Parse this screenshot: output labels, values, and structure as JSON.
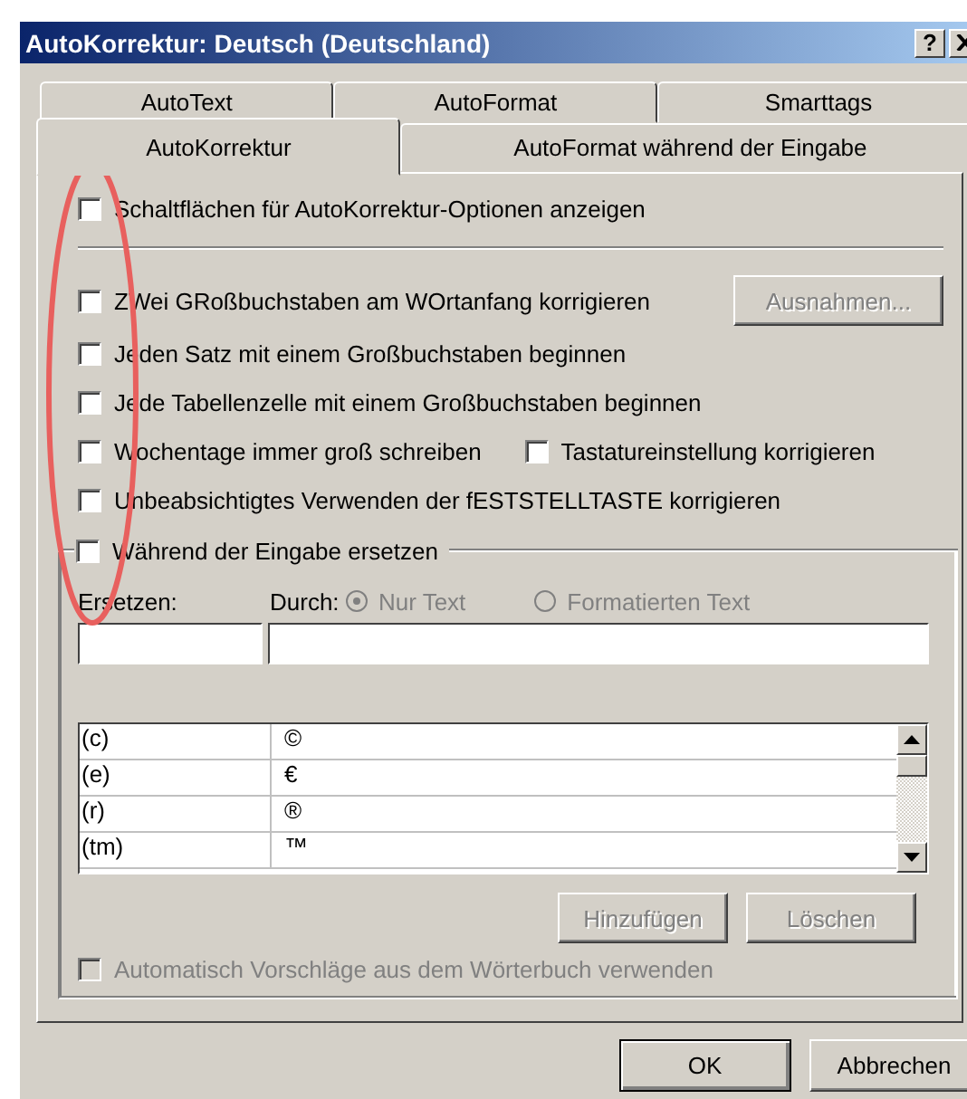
{
  "window": {
    "title": "AutoKorrektur: Deutsch (Deutschland)",
    "help_button": "?"
  },
  "tab_rows": [
    [
      {
        "label": "AutoText",
        "selected": false
      },
      {
        "label": "AutoFormat",
        "selected": false
      },
      {
        "label": "Smarttags",
        "selected": false
      }
    ],
    [
      {
        "label": "AutoKorrektur",
        "selected": true
      },
      {
        "label": "AutoFormat während der Eingabe",
        "selected": false
      }
    ]
  ],
  "top_option": {
    "label": "Schaltflächen für AutoKorrektur-Optionen anzeigen",
    "checked": false
  },
  "option_rows": [
    {
      "items": [
        {
          "label": "ZWei GRoßbuchstaben am WOrtanfang korrigieren",
          "checked": false
        }
      ],
      "button": {
        "label": "Ausnahmen...",
        "disabled": true
      }
    },
    {
      "items": [
        {
          "label": "Jeden Satz mit einem Großbuchstaben beginnen",
          "checked": false
        }
      ]
    },
    {
      "items": [
        {
          "label": "Jede Tabellenzelle mit einem Großbuchstaben beginnen",
          "checked": false
        }
      ]
    },
    {
      "items": [
        {
          "label": "Wochentage immer groß schreiben",
          "checked": false
        },
        {
          "label": "Tastatureinstellung korrigieren",
          "checked": false
        }
      ]
    },
    {
      "items": [
        {
          "label": "Unbeabsichtigtes Verwenden der fESTSTELLTASTE korrigieren",
          "checked": false
        }
      ]
    }
  ],
  "replace_group": {
    "checkbox": {
      "label": "Während der Eingabe ersetzen",
      "checked": false
    },
    "replace_label": "Ersetzen:",
    "with_label": "Durch:",
    "radios": [
      {
        "label": "Nur Text",
        "selected": true,
        "disabled": true
      },
      {
        "label": "Formatierten Text",
        "selected": false,
        "disabled": true
      }
    ],
    "entries": [
      {
        "from": "(c)",
        "to": "©"
      },
      {
        "from": "(e)",
        "to": "€"
      },
      {
        "from": "(r)",
        "to": "®"
      },
      {
        "from": "(tm)",
        "to": "™"
      }
    ],
    "buttons": [
      {
        "label": "Hinzufügen",
        "disabled": true
      },
      {
        "label": "Löschen",
        "disabled": true
      }
    ],
    "suggest": {
      "label": "Automatisch Vorschläge aus dem Wörterbuch verwenden",
      "checked": false,
      "disabled": true
    }
  },
  "footer_buttons": [
    {
      "label": "OK",
      "disabled": false,
      "default": true
    },
    {
      "label": "Abbrechen",
      "disabled": false,
      "default": false
    }
  ]
}
